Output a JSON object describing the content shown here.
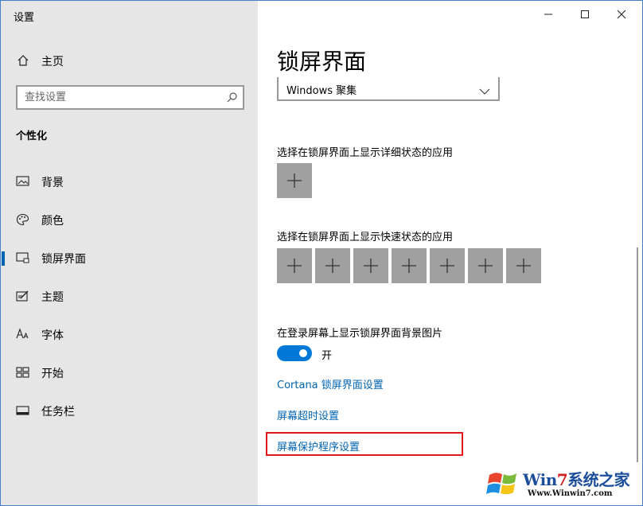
{
  "window": {
    "title": "设置"
  },
  "sidebar": {
    "home_label": "主页",
    "search_placeholder": "查找设置",
    "section_title": "个性化",
    "items": [
      {
        "label": "背景",
        "icon": "picture-icon"
      },
      {
        "label": "颜色",
        "icon": "palette-icon"
      },
      {
        "label": "锁屏界面",
        "icon": "lock-screen-icon",
        "active": true
      },
      {
        "label": "主题",
        "icon": "theme-icon"
      },
      {
        "label": "字体",
        "icon": "font-icon"
      },
      {
        "label": "开始",
        "icon": "start-icon"
      },
      {
        "label": "任务栏",
        "icon": "taskbar-icon"
      }
    ]
  },
  "main": {
    "title": "锁屏界面",
    "background_dropdown_value": "Windows 聚集",
    "detailed_status_label": "选择在锁屏界面上显示详细状态的应用",
    "quick_status_label": "选择在锁屏界面上显示快速状态的应用",
    "quick_status_tile_count": 7,
    "signin_background_label": "在登录屏幕上显示锁屏界面背景图片",
    "signin_background_toggle": {
      "state": "on",
      "label": "开"
    },
    "links": {
      "cortana": "Cortana 锁屏界面设置",
      "screen_timeout": "屏幕超时设置",
      "screen_saver": "屏幕保护程序设置"
    }
  },
  "watermark": {
    "brand_prefix": "Win",
    "brand_seven": "7",
    "brand_suffix": "系统之家",
    "site": "Www.Winwin7.com"
  },
  "colors": {
    "accent": "#0078d7",
    "link": "#0063b1",
    "sidebar_bg": "#e6e6e6",
    "tile_bg": "#a0a0a0",
    "highlight": "#e0181b"
  }
}
